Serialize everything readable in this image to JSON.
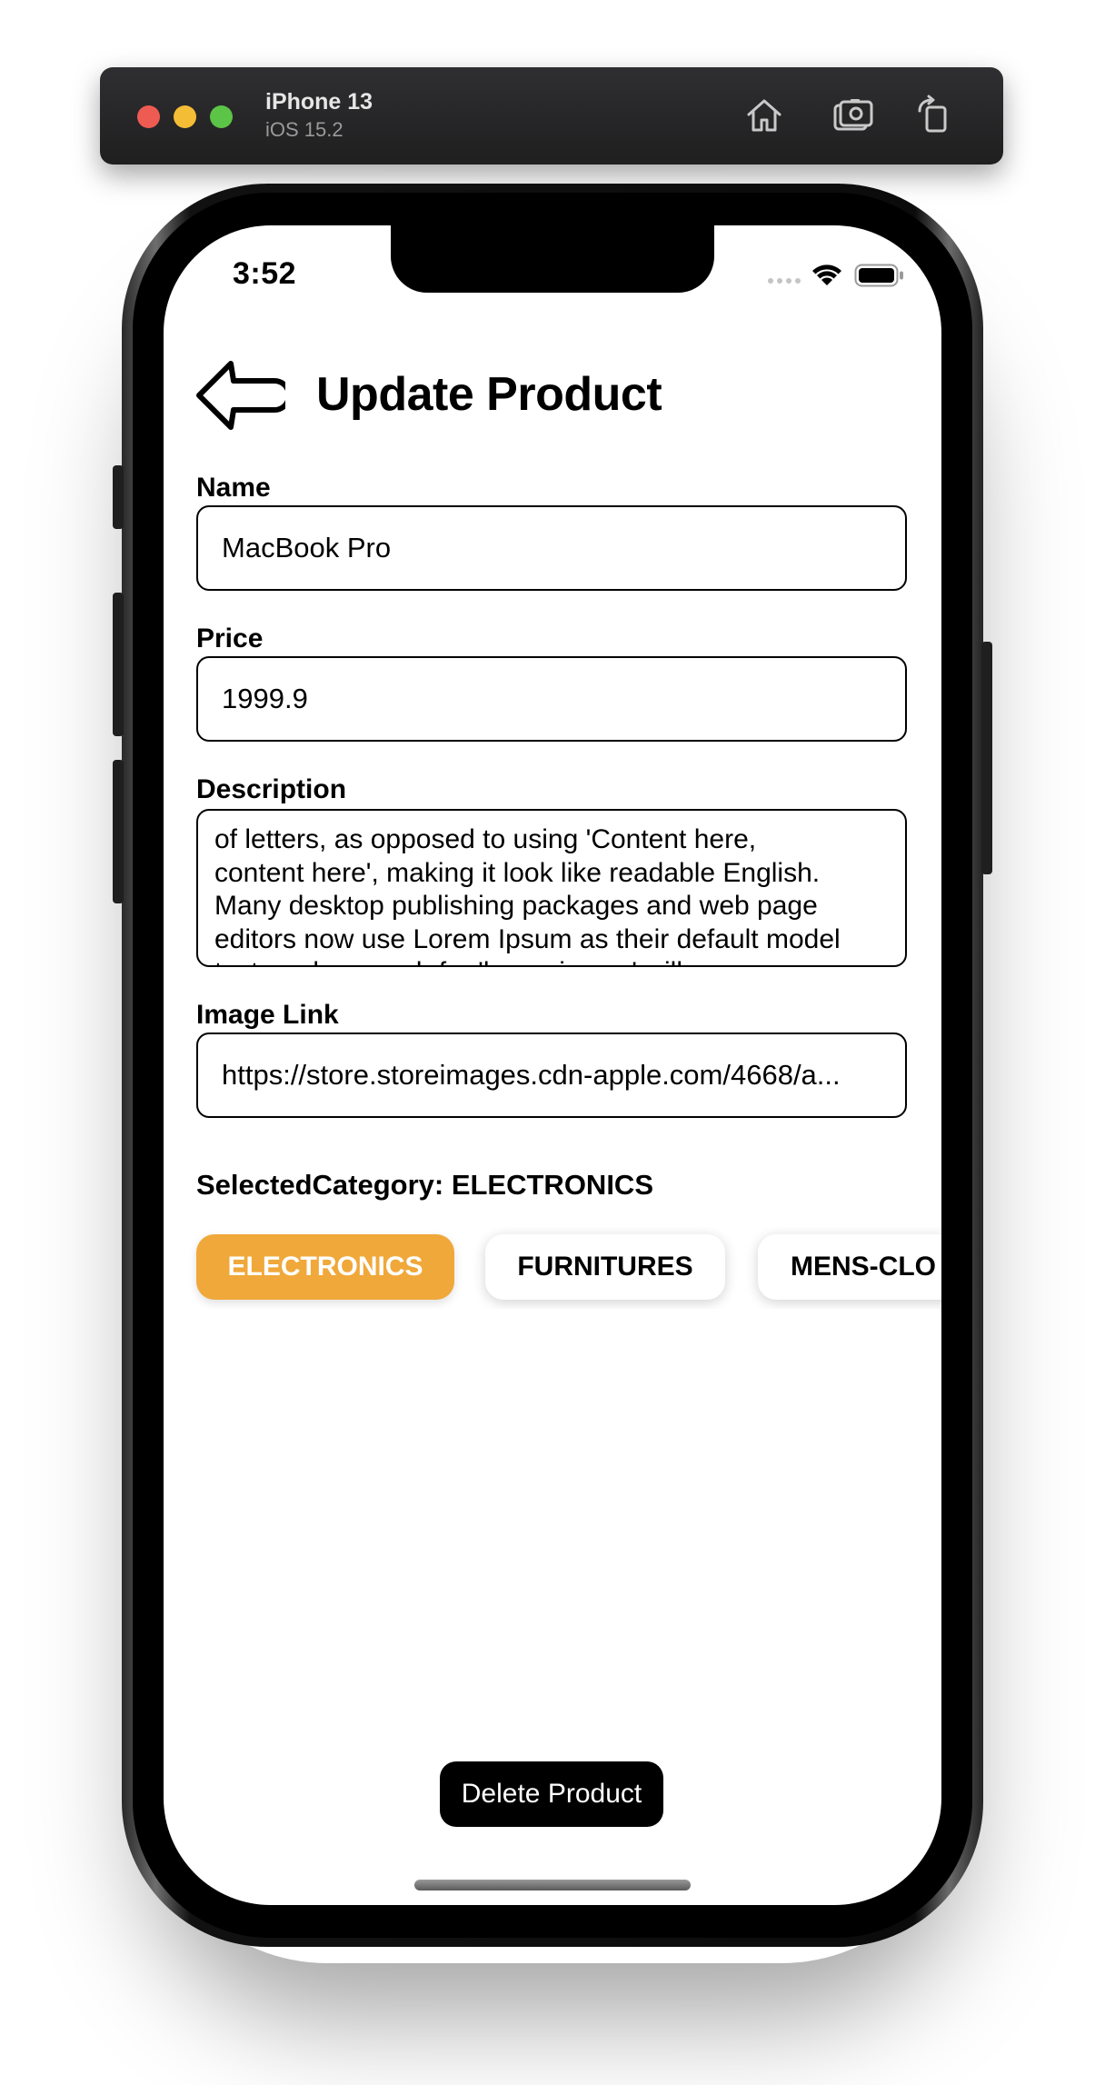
{
  "simulator": {
    "device_name": "iPhone 13",
    "os_version": "iOS 15.2",
    "icons": [
      "home-icon",
      "screenshot-icon",
      "rotate-icon"
    ]
  },
  "status_bar": {
    "time": "3:52",
    "icons": [
      "cellular-signal-icon",
      "wifi-icon",
      "battery-icon"
    ]
  },
  "header": {
    "back_icon": "back-arrow-icon",
    "title": "Update Product"
  },
  "form": {
    "name": {
      "label": "Name",
      "value": "MacBook Pro"
    },
    "price": {
      "label": "Price",
      "value": "1999.9"
    },
    "description": {
      "label": "Description",
      "lines": [
        "of letters, as opposed to using 'Content here,",
        "content here', making it look like readable English.",
        "Many desktop publishing packages and web page",
        "editors now use Lorem Ipsum as their default model",
        "text, and a search for 'lorem ipsum' will uncover"
      ]
    },
    "image_link": {
      "label": "Image Link",
      "value": "https://store.storeimages.cdn-apple.com/4668/a..."
    }
  },
  "category": {
    "selected_label": "SelectedCategory: ELECTRONICS",
    "options": [
      "ELECTRONICS",
      "FURNITURES",
      "MENS-CLO"
    ],
    "active_index": 0,
    "active_color": "#f0a83a"
  },
  "actions": {
    "delete_label": "Delete Product"
  }
}
